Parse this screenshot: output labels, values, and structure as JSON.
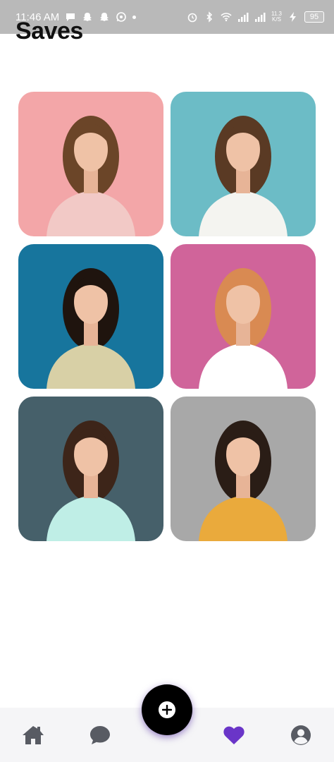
{
  "status_bar": {
    "time": "11:46 AM",
    "net_speed_value": "11.3",
    "net_speed_unit": "K/S",
    "battery": "95"
  },
  "header": {
    "title": "Saves"
  },
  "saves": [
    {
      "bg": "#f3a6a8",
      "accent": "#f2c9c6",
      "hair": "#6b4528"
    },
    {
      "bg": "#6cbcc6",
      "accent": "#f4f4f0",
      "hair": "#5a3a24"
    },
    {
      "bg": "#17759d",
      "accent": "#d8d0a6",
      "hair": "#1f140e"
    },
    {
      "bg": "#d0649a",
      "accent": "#ffffff",
      "hair": "#d98a52"
    },
    {
      "bg": "#46606a",
      "accent": "#bfeee6",
      "hair": "#3d2519"
    },
    {
      "bg": "#a8a8a8",
      "accent": "#eaaa3c",
      "hair": "#2a1d16"
    }
  ],
  "nav": {
    "items": [
      "home-icon",
      "chat-icon",
      "add-icon",
      "heart-icon",
      "profile-icon"
    ],
    "active": "heart-icon",
    "colors": {
      "inactive": "#585b63",
      "active": "#6a35c8",
      "fab": "#000000"
    }
  }
}
